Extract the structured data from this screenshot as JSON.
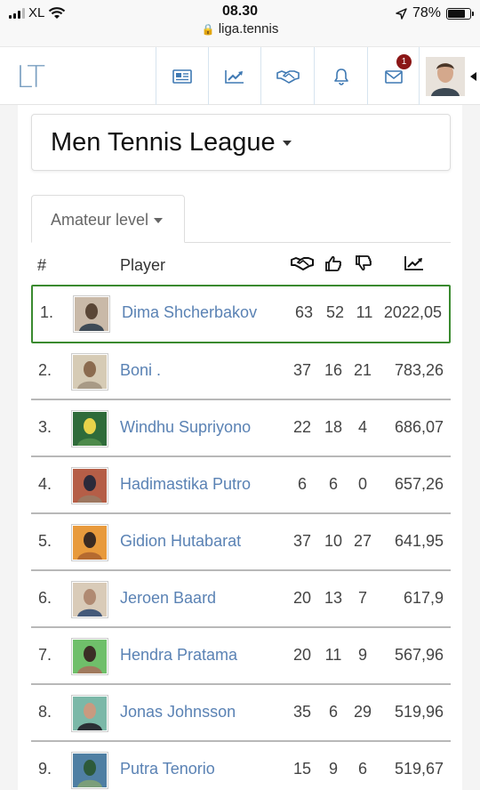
{
  "status_bar": {
    "carrier": "XL",
    "time": "08.30",
    "url": "liga.tennis",
    "battery": "78%",
    "battery_level": 0.78
  },
  "navbar": {
    "logo": "LT",
    "notification_badge": "1",
    "icons": [
      "newspaper-icon",
      "chart-icon",
      "handshake-icon",
      "bell-icon",
      "mail-icon"
    ]
  },
  "league": {
    "title": "Men Tennis League"
  },
  "tab": {
    "label": "Amateur level"
  },
  "table": {
    "headers": {
      "rank": "#",
      "player": "Player"
    },
    "rows": [
      {
        "rank": "1.",
        "name": "Dima Shcherbakov",
        "matches": "63",
        "wins": "52",
        "losses": "11",
        "score": "2022,05",
        "highlight": true,
        "avatar_colors": [
          "#c9b9a8",
          "#5a4636",
          "#3e4a56"
        ]
      },
      {
        "rank": "2.",
        "name": "Boni .",
        "matches": "37",
        "wins": "16",
        "losses": "21",
        "score": "783,26",
        "avatar_colors": [
          "#d6cbb5",
          "#8b6b4f",
          "#a89a86"
        ]
      },
      {
        "rank": "3.",
        "name": "Windhu Supriyono",
        "matches": "22",
        "wins": "18",
        "losses": "4",
        "score": "686,07",
        "avatar_colors": [
          "#2f6b3a",
          "#e7d34a",
          "#4d8a4a"
        ]
      },
      {
        "rank": "4.",
        "name": "Hadimastika Putro",
        "matches": "6",
        "wins": "6",
        "losses": "0",
        "score": "657,26",
        "avatar_colors": [
          "#b55e47",
          "#2c2a3a",
          "#9d7760"
        ]
      },
      {
        "rank": "5.",
        "name": "Gidion Hutabarat",
        "matches": "37",
        "wins": "10",
        "losses": "27",
        "score": "641,95",
        "avatar_colors": [
          "#e89a3c",
          "#3a2a22",
          "#b56a30"
        ]
      },
      {
        "rank": "6.",
        "name": "Jeroen Baard",
        "matches": "20",
        "wins": "13",
        "losses": "7",
        "score": "617,9",
        "avatar_colors": [
          "#d9cbb8",
          "#b08a72",
          "#455a7a"
        ]
      },
      {
        "rank": "7.",
        "name": "Hendra Pratama",
        "matches": "20",
        "wins": "11",
        "losses": "9",
        "score": "567,96",
        "avatar_colors": [
          "#6fbf6a",
          "#3b2e26",
          "#a07a5e"
        ]
      },
      {
        "rank": "8.",
        "name": "Jonas Johnsson",
        "matches": "35",
        "wins": "6",
        "losses": "29",
        "score": "519,96",
        "avatar_colors": [
          "#7bb8a8",
          "#c99a80",
          "#2b2f35"
        ]
      },
      {
        "rank": "9.",
        "name": "Putra Tenorio",
        "matches": "15",
        "wins": "9",
        "losses": "6",
        "score": "519,67",
        "avatar_colors": [
          "#4f7fa3",
          "#2d5a3a",
          "#7a9e7a"
        ]
      }
    ]
  }
}
